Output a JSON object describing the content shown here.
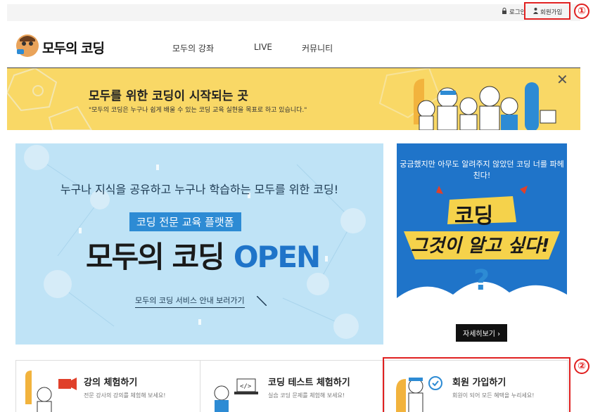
{
  "topbar": {
    "login": "로그인",
    "signup": "회원가입",
    "marker_1": "①",
    "marker_2": "②"
  },
  "header": {
    "logo": "모두의 코딩",
    "nav": [
      "모두의 강좌",
      "LIVE",
      "커뮤니티"
    ]
  },
  "banner": {
    "title": "모두를 위한 코딩이 시작되는 곳",
    "subtitle": "\"모두의 코딩은 누구나 쉽게 배울 수 있는 코딩 교육 실현을 목표로 하고 있습니다.\"",
    "close": "✕"
  },
  "hero": {
    "line1": "누구나 지식을 공유하고 누구나 학습하는 모두를 위한 코딩!",
    "badge": "코딩 전문 교육 플랫폼",
    "big_dark": "모두의 코딩",
    "big_blue": "OPEN",
    "link": "모두의 코딩 서비스 안내 보러가기"
  },
  "side": {
    "top": "궁금했지만 아무도 알려주지 않았던 코딩 너를 파헤친다!",
    "word1": "코딩",
    "word2": "그것이 알고 싶다!",
    "button": "자세히보기 ›"
  },
  "cards": [
    {
      "title": "강의 체험하기",
      "desc": "전문 강사의 강의를 체험해 보세요!"
    },
    {
      "title": "코딩 테스트 체험하기",
      "desc": "실습 코딩 문제를 체험해 보세요!"
    },
    {
      "title": "회원 가입하기",
      "desc": "회원이 되어 모든 혜택을 누리세요!"
    }
  ],
  "colors": {
    "accent_blue": "#1f74c9",
    "banner_yellow": "#f9d866",
    "highlight_red": "#e02020"
  }
}
